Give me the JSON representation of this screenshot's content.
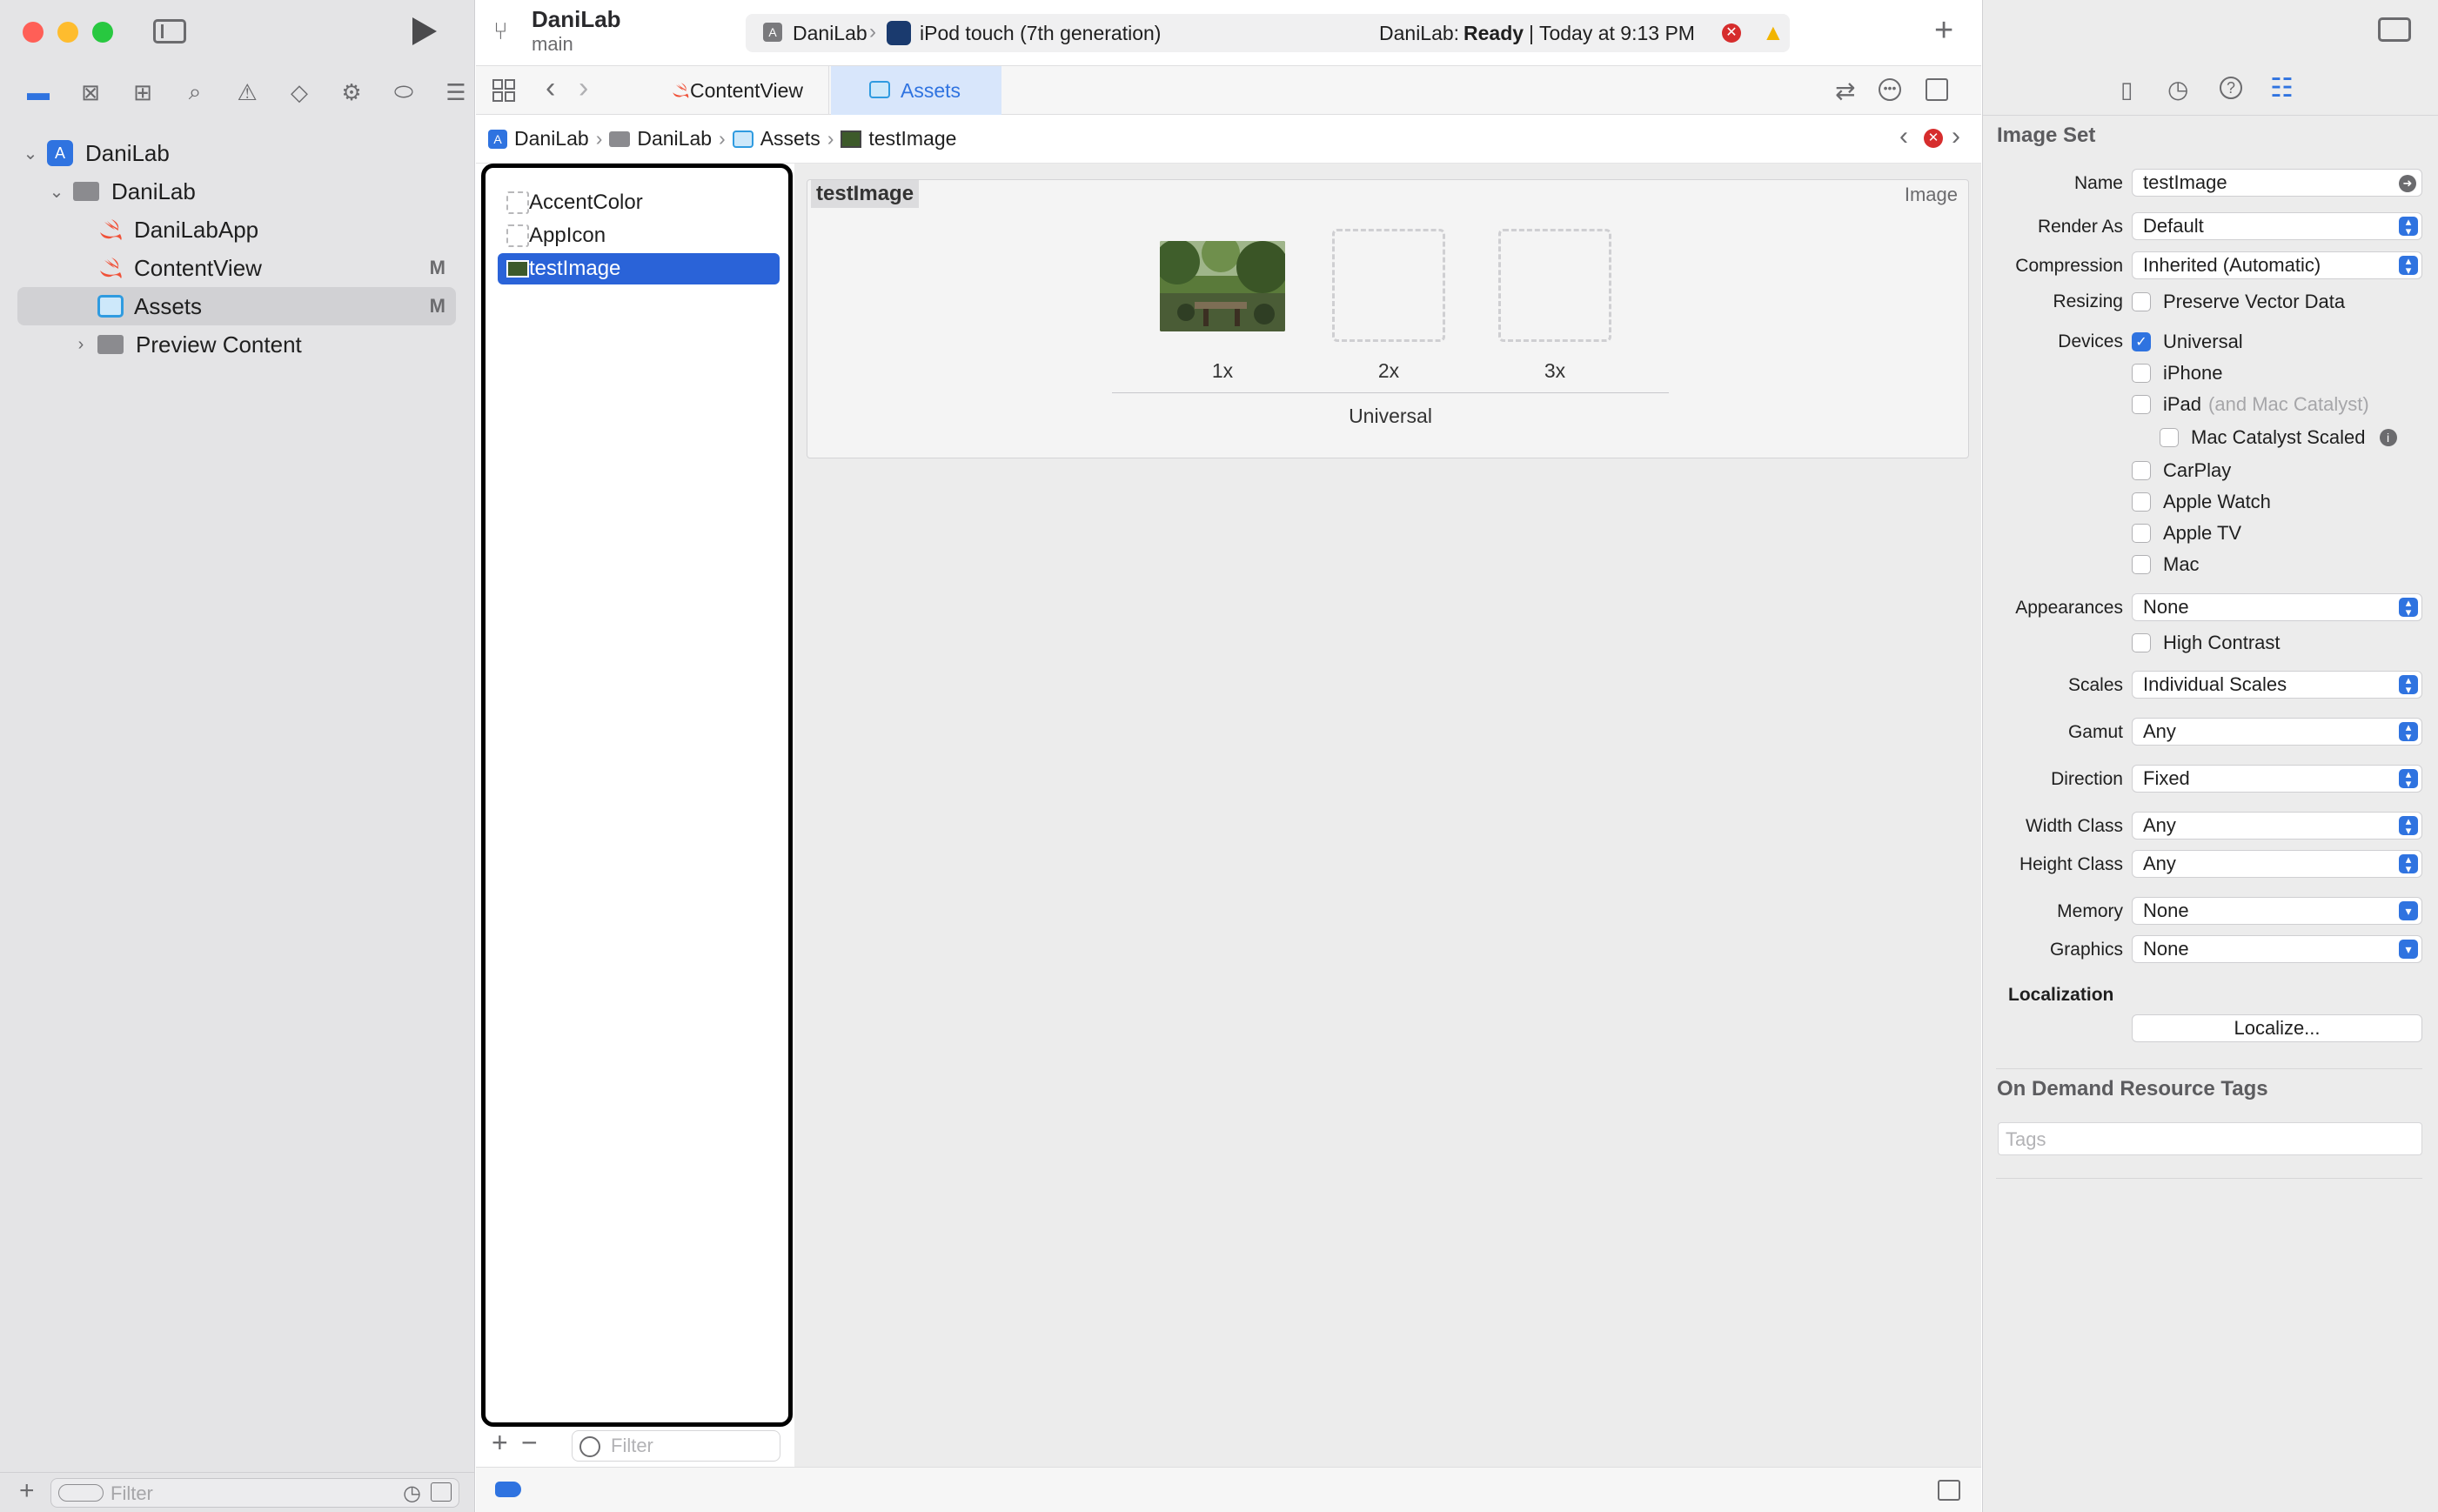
{
  "toolbar": {
    "project": "DaniLab",
    "branch": "main",
    "scheme": "DaniLab",
    "device": "iPod touch (7th generation)",
    "status_prefix": "DaniLab:",
    "status_state": "Ready",
    "status_time": "| Today at 9:13 PM"
  },
  "navigator": {
    "items": [
      {
        "label": "DaniLab",
        "badge": ""
      },
      {
        "label": "DaniLab",
        "badge": ""
      },
      {
        "label": "DaniLabApp",
        "badge": ""
      },
      {
        "label": "ContentView",
        "badge": "M"
      },
      {
        "label": "Assets",
        "badge": "M"
      },
      {
        "label": "Preview Content",
        "badge": ""
      }
    ],
    "filter_placeholder": "Filter"
  },
  "tabs": [
    {
      "label": "ContentView"
    },
    {
      "label": "Assets"
    }
  ],
  "breadcrumb": [
    "DaniLab",
    "DaniLab",
    "Assets",
    "testImage"
  ],
  "asset_list": {
    "items": [
      "AccentColor",
      "AppIcon",
      "testImage"
    ],
    "selected": "testImage",
    "filter_placeholder": "Filter"
  },
  "image_set": {
    "title": "testImage",
    "kind": "Image",
    "scales": [
      "1x",
      "2x",
      "3x"
    ],
    "group_label": "Universal"
  },
  "inspector": {
    "title": "Image Set",
    "name_label": "Name",
    "name_value": "testImage",
    "render_as_label": "Render As",
    "render_as": "Default",
    "compression_label": "Compression",
    "compression": "Inherited (Automatic)",
    "resizing_label": "Resizing",
    "preserve_vector": "Preserve Vector Data",
    "devices_label": "Devices",
    "devices": {
      "universal": "Universal",
      "iphone": "iPhone",
      "ipad": "iPad",
      "ipad_note": "(and Mac Catalyst)",
      "mac_catalyst_scaled": "Mac Catalyst Scaled",
      "carplay": "CarPlay",
      "apple_watch": "Apple Watch",
      "apple_tv": "Apple TV",
      "mac": "Mac"
    },
    "appearances_label": "Appearances",
    "appearances": "None",
    "high_contrast": "High Contrast",
    "scales_label": "Scales",
    "scales": "Individual Scales",
    "gamut_label": "Gamut",
    "gamut": "Any",
    "direction_label": "Direction",
    "direction": "Fixed",
    "width_class_label": "Width Class",
    "width_class": "Any",
    "height_class_label": "Height Class",
    "height_class": "Any",
    "memory_label": "Memory",
    "memory": "None",
    "graphics_label": "Graphics",
    "graphics": "None",
    "localization_label": "Localization",
    "localize_button": "Localize...",
    "odr_title": "On Demand Resource Tags",
    "tags_placeholder": "Tags"
  },
  "colors": {
    "accent": "#2f73e0",
    "selection": "#2a63d8",
    "swift": "#f05138",
    "error": "#d62d2d",
    "warning": "#f2b400"
  }
}
